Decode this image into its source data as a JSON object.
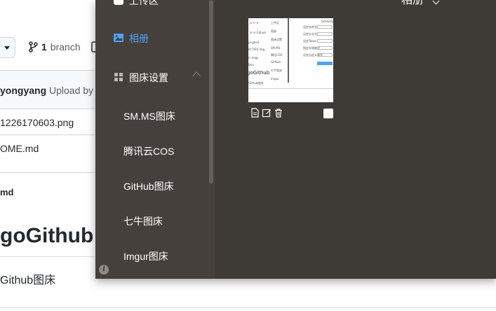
{
  "github": {
    "branch_count": "1",
    "branch_label": "branch",
    "commit_author": "yongyang",
    "commit_message": "Upload by P",
    "files": [
      "1226170603.png",
      "OME.md"
    ],
    "readme_header": "md",
    "readme_title": "goGithub",
    "readme_text": "Github图床"
  },
  "app": {
    "title": "相册",
    "sidebar": {
      "upload_label": "上传区",
      "album_label": "相册",
      "picbed_label": "图床设置",
      "picbeds": [
        "SM.MS图床",
        "腾讯云COS",
        "GitHub图床",
        "七牛图床",
        "Imgur图床"
      ]
    },
    "thumbnail": {
      "caption": "goGithub"
    },
    "colors": {
      "accent": "#4aa3ff",
      "sidebar_bg": "#45403b",
      "main_bg": "#3e3a35"
    },
    "icons": [
      "upload-icon",
      "image-icon",
      "grid-icon",
      "chevron-up-icon",
      "info-icon",
      "document-icon",
      "edit-icon",
      "trash-icon"
    ]
  }
}
